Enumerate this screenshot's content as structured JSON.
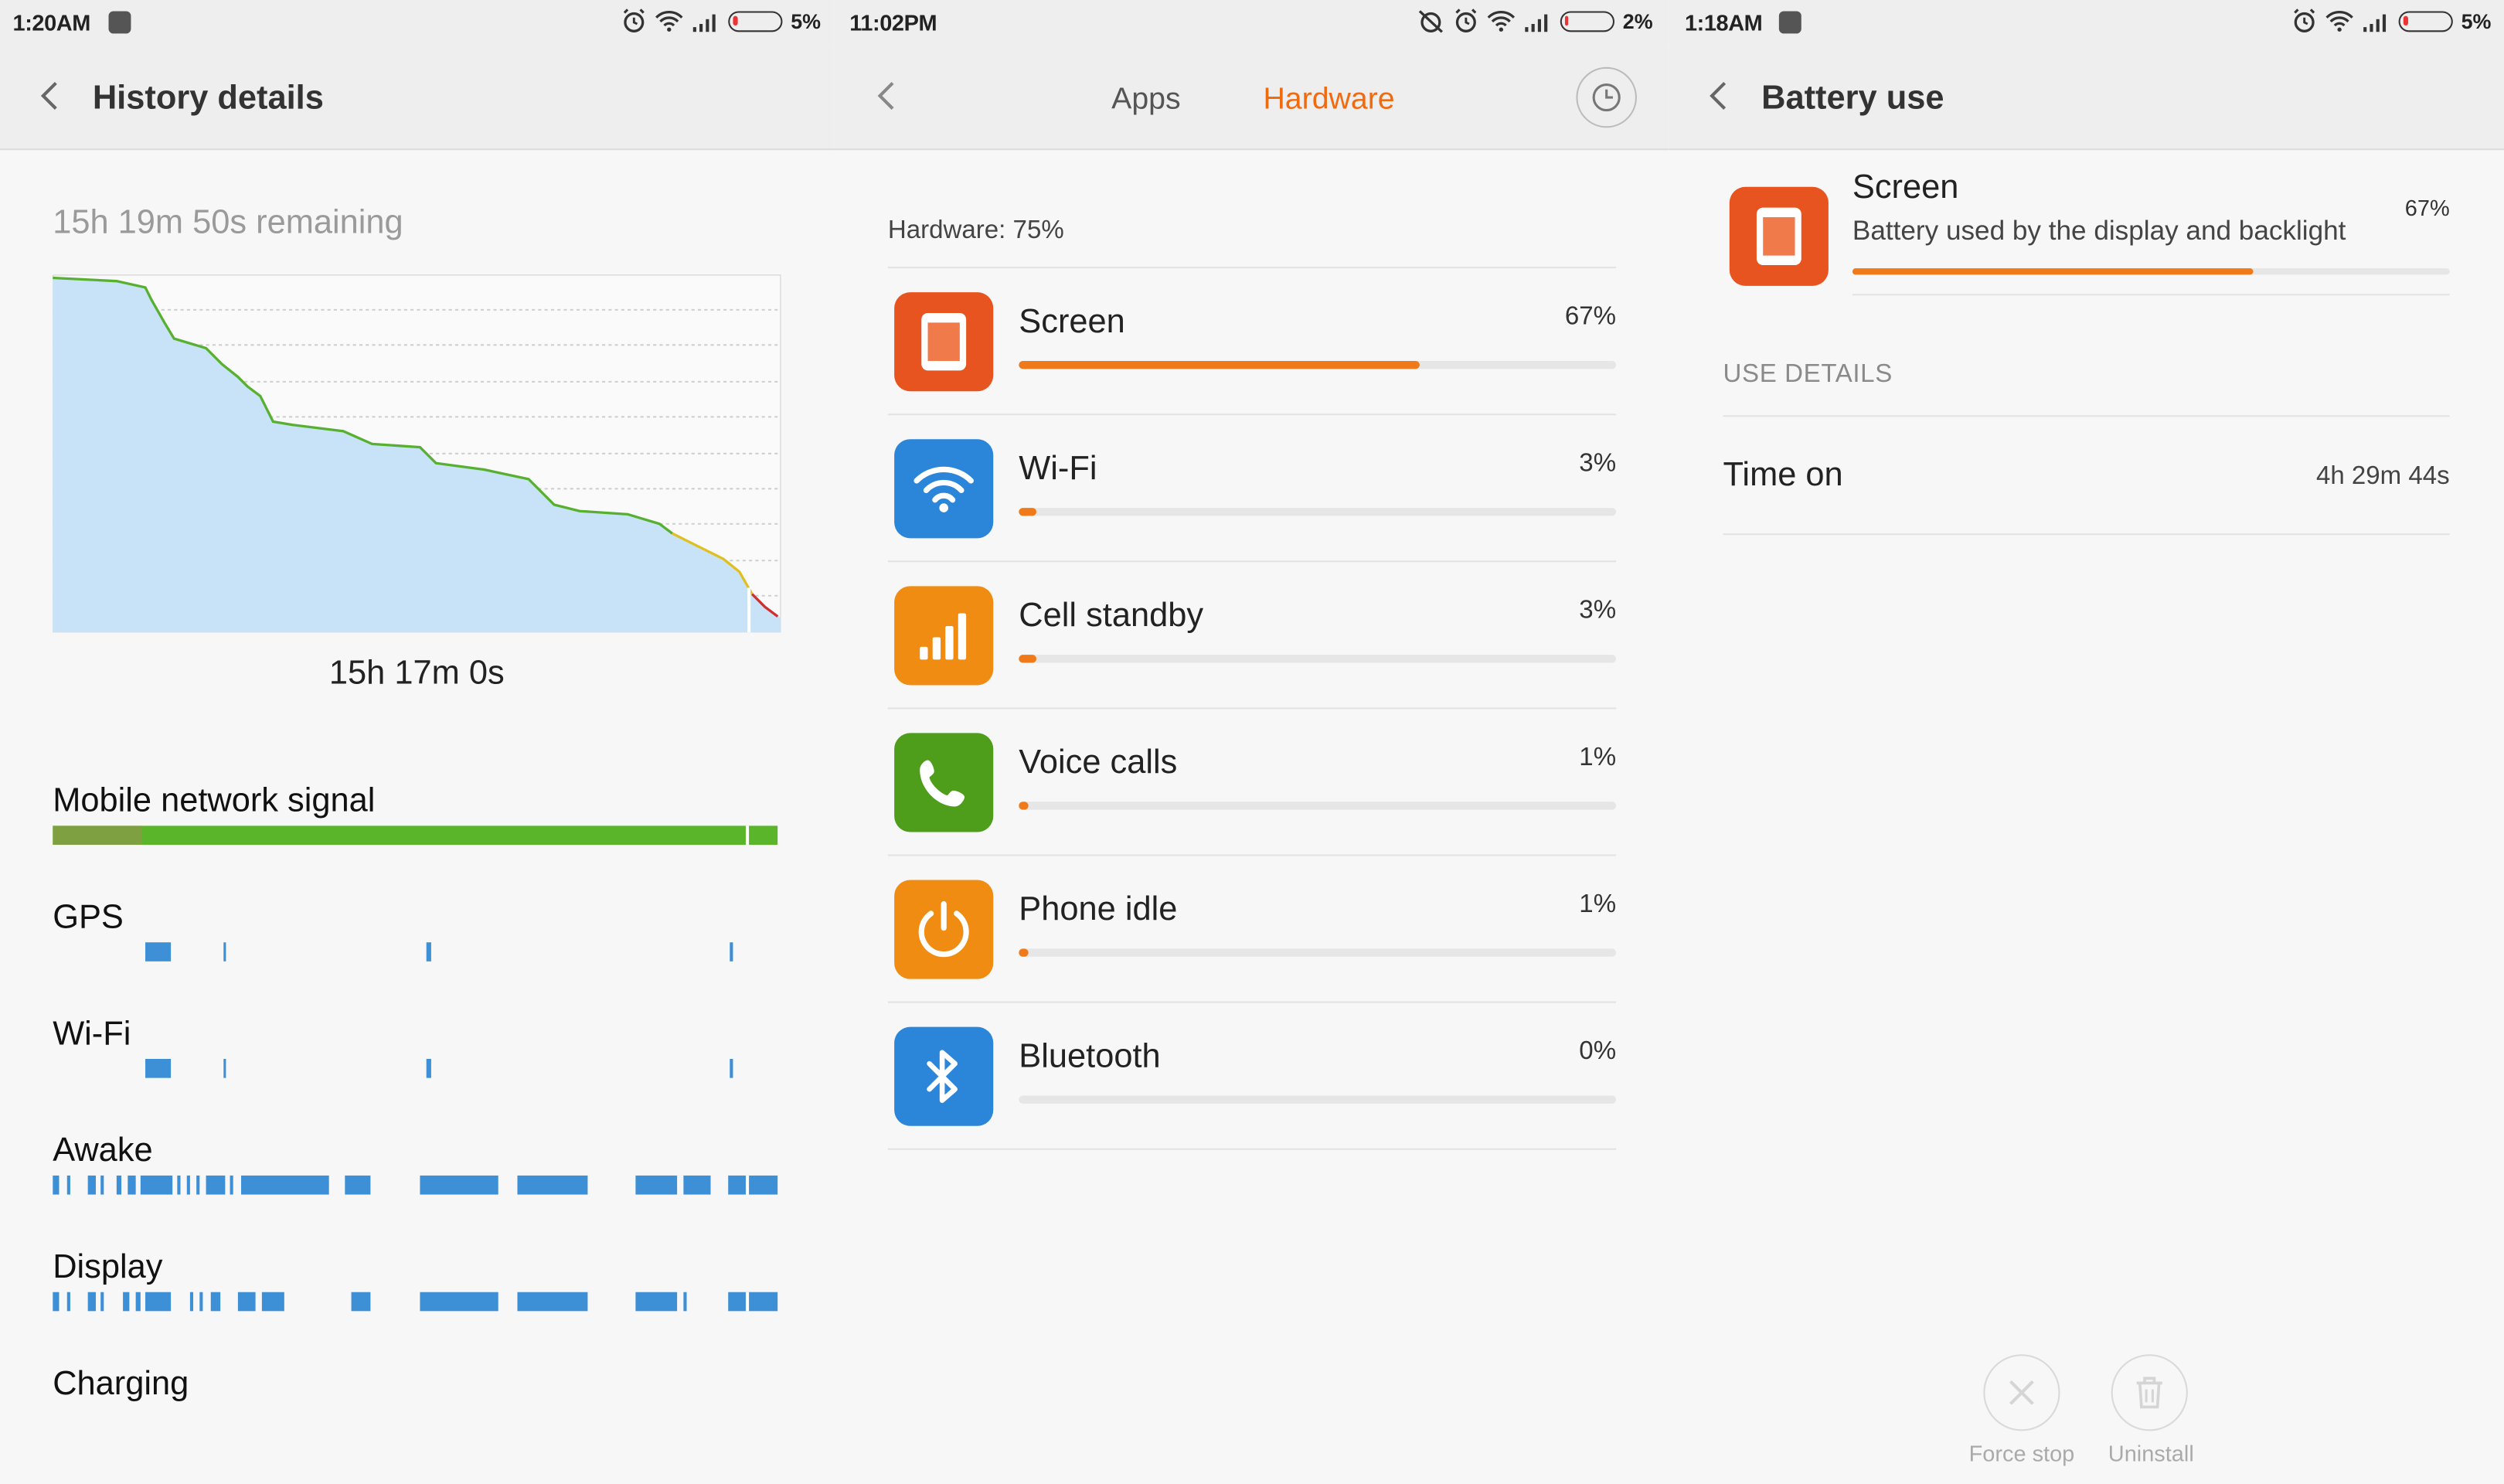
{
  "panel1": {
    "status": {
      "time": "1:20AM",
      "battery": "5%"
    },
    "title": "History details",
    "remaining": "15h 19m 50s remaining",
    "duration": "15h 17m 0s",
    "rows": {
      "mobile": "Mobile network signal",
      "gps": "GPS",
      "wifi": "Wi-Fi",
      "awake": "Awake",
      "display": "Display",
      "charging": "Charging"
    },
    "colors": {
      "level_line": "#58b030",
      "fill": "#c8e3f8",
      "track": "#3d8fd6",
      "signal": "#5bb52a"
    }
  },
  "panel2": {
    "status": {
      "time": "11:02PM",
      "battery": "2%"
    },
    "tabs": {
      "apps": "Apps",
      "hardware": "Hardware"
    },
    "accent": "#f06a10",
    "summary": "Hardware: 75%",
    "items": [
      {
        "name": "Screen",
        "pct": "67%",
        "value": 67,
        "icon": "screen-icon",
        "color": "#e8541f"
      },
      {
        "name": "Wi-Fi",
        "pct": "3%",
        "value": 3,
        "icon": "wifi-icon",
        "color": "#2b86da"
      },
      {
        "name": "Cell standby",
        "pct": "3%",
        "value": 3,
        "icon": "cell-signal-icon",
        "color": "#f08c12"
      },
      {
        "name": "Voice calls",
        "pct": "1%",
        "value": 1,
        "icon": "phone-icon",
        "color": "#4e9e1c"
      },
      {
        "name": "Phone idle",
        "pct": "1%",
        "value": 1,
        "icon": "power-icon",
        "color": "#f08c12"
      },
      {
        "name": "Bluetooth",
        "pct": "0%",
        "value": 0,
        "icon": "bluetooth-icon",
        "color": "#2b86da"
      }
    ]
  },
  "panel3": {
    "status": {
      "time": "1:18AM",
      "battery": "5%"
    },
    "title": "Battery use",
    "name": "Screen",
    "desc": "Battery used by the display and backlight",
    "pct": "67%",
    "value": 67,
    "section": "USE DETAILS",
    "time_on_label": "Time on",
    "time_on_value": "4h 29m 44s",
    "force_stop": "Force stop",
    "uninstall": "Uninstall"
  }
}
